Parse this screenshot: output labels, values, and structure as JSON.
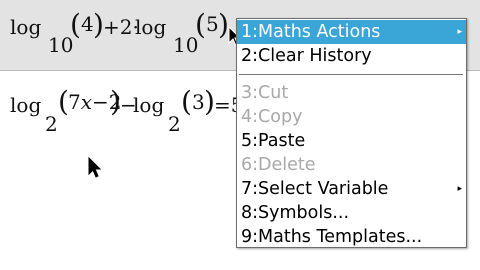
{
  "history": [
    {
      "log1": "log",
      "base1": "10",
      "arg1": "4",
      "op": "+2·",
      "log2": "log",
      "base2": "10",
      "arg2": "5"
    },
    {
      "log1": "log",
      "base1": "2",
      "arg1": "7x−2",
      "op": "−",
      "log2": "log",
      "base2": "2",
      "arg2": "3",
      "rhs": "=5"
    }
  ],
  "context_menu": {
    "items": [
      {
        "label": "1:Maths Actions",
        "state": "selected",
        "submenu": true
      },
      {
        "label": "2:Clear History",
        "state": "enabled",
        "submenu": false
      },
      {
        "label": "3:Cut",
        "state": "disabled",
        "submenu": false
      },
      {
        "label": "4:Copy",
        "state": "disabled",
        "submenu": false
      },
      {
        "label": "5:Paste",
        "state": "enabled",
        "submenu": false
      },
      {
        "label": "6:Delete",
        "state": "disabled",
        "submenu": false
      },
      {
        "label": "7:Select Variable",
        "state": "enabled",
        "submenu": true
      },
      {
        "label": "8:Symbols...",
        "state": "enabled",
        "submenu": false
      },
      {
        "label": "9:Maths Templates...",
        "state": "enabled",
        "submenu": false
      }
    ],
    "submenu_arrow": "▸"
  },
  "colors": {
    "selected_bg": "#3aa6d8",
    "history_row_bg": "#e3e3e3",
    "disabled_text": "#a9a9a9"
  },
  "icons": {
    "pointer": "arrow-cursor-icon"
  }
}
